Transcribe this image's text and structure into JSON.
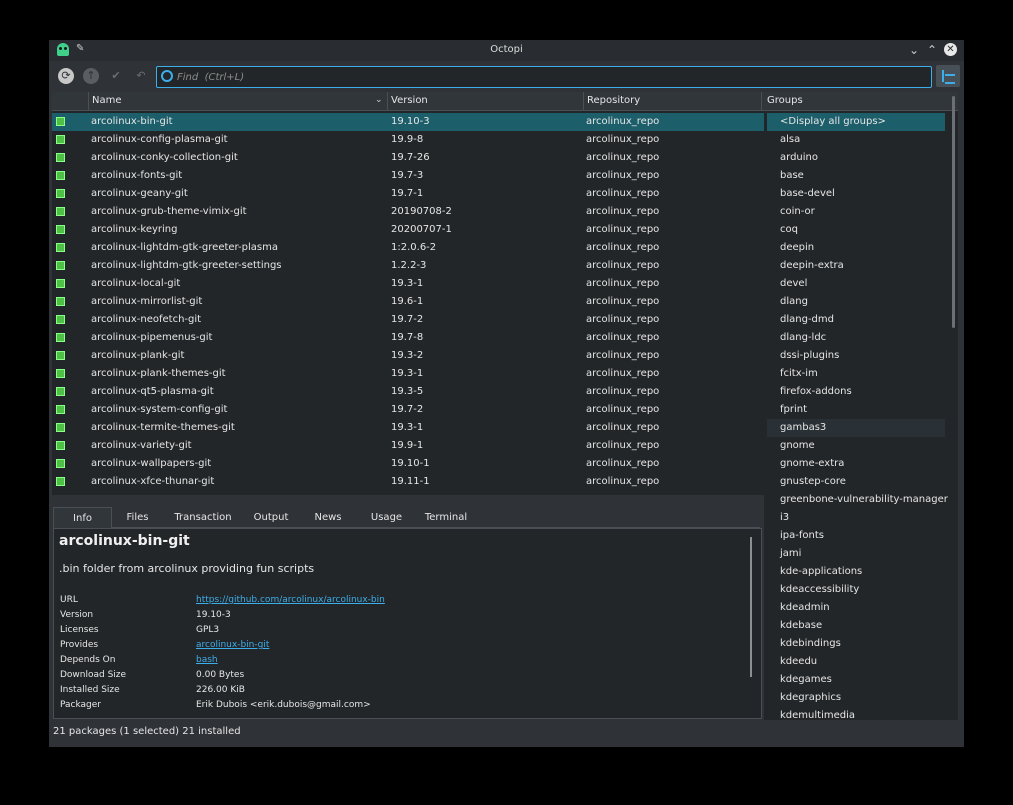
{
  "window": {
    "title": "Octopi"
  },
  "search": {
    "placeholder": "Find  (Ctrl+L)"
  },
  "columns": {
    "name": "Name",
    "version": "Version",
    "repository": "Repository",
    "groups": "Groups"
  },
  "packages": [
    {
      "name": "arcolinux-bin-git",
      "version": "19.10-3",
      "repo": "arcolinux_repo",
      "selected": true
    },
    {
      "name": "arcolinux-config-plasma-git",
      "version": "19.9-8",
      "repo": "arcolinux_repo"
    },
    {
      "name": "arcolinux-conky-collection-git",
      "version": "19.7-26",
      "repo": "arcolinux_repo"
    },
    {
      "name": "arcolinux-fonts-git",
      "version": "19.7-3",
      "repo": "arcolinux_repo"
    },
    {
      "name": "arcolinux-geany-git",
      "version": "19.7-1",
      "repo": "arcolinux_repo"
    },
    {
      "name": "arcolinux-grub-theme-vimix-git",
      "version": "20190708-2",
      "repo": "arcolinux_repo"
    },
    {
      "name": "arcolinux-keyring",
      "version": "20200707-1",
      "repo": "arcolinux_repo"
    },
    {
      "name": "arcolinux-lightdm-gtk-greeter-plasma",
      "version": "1:2.0.6-2",
      "repo": "arcolinux_repo"
    },
    {
      "name": "arcolinux-lightdm-gtk-greeter-settings",
      "version": "1.2.2-3",
      "repo": "arcolinux_repo"
    },
    {
      "name": "arcolinux-local-git",
      "version": "19.3-1",
      "repo": "arcolinux_repo"
    },
    {
      "name": "arcolinux-mirrorlist-git",
      "version": "19.6-1",
      "repo": "arcolinux_repo"
    },
    {
      "name": "arcolinux-neofetch-git",
      "version": "19.7-2",
      "repo": "arcolinux_repo"
    },
    {
      "name": "arcolinux-pipemenus-git",
      "version": "19.7-8",
      "repo": "arcolinux_repo"
    },
    {
      "name": "arcolinux-plank-git",
      "version": "19.3-2",
      "repo": "arcolinux_repo"
    },
    {
      "name": "arcolinux-plank-themes-git",
      "version": "19.3-1",
      "repo": "arcolinux_repo"
    },
    {
      "name": "arcolinux-qt5-plasma-git",
      "version": "19.3-5",
      "repo": "arcolinux_repo"
    },
    {
      "name": "arcolinux-system-config-git",
      "version": "19.7-2",
      "repo": "arcolinux_repo"
    },
    {
      "name": "arcolinux-termite-themes-git",
      "version": "19.3-1",
      "repo": "arcolinux_repo"
    },
    {
      "name": "arcolinux-variety-git",
      "version": "19.9-1",
      "repo": "arcolinux_repo"
    },
    {
      "name": "arcolinux-wallpapers-git",
      "version": "19.10-1",
      "repo": "arcolinux_repo"
    },
    {
      "name": "arcolinux-xfce-thunar-git",
      "version": "19.11-1",
      "repo": "arcolinux_repo"
    }
  ],
  "groups": [
    "<Display all groups>",
    "alsa",
    "arduino",
    "base",
    "base-devel",
    "coin-or",
    "coq",
    "deepin",
    "deepin-extra",
    "devel",
    "dlang",
    "dlang-dmd",
    "dlang-ldc",
    "dssi-plugins",
    "fcitx-im",
    "firefox-addons",
    "fprint",
    "gambas3",
    "gnome",
    "gnome-extra",
    "gnustep-core",
    "greenbone-vulnerability-manager",
    "i3",
    "ipa-fonts",
    "jami",
    "kde-applications",
    "kdeaccessibility",
    "kdeadmin",
    "kdebase",
    "kdebindings",
    "kdeedu",
    "kdegames",
    "kdegraphics",
    "kdemultimedia"
  ],
  "tabs": [
    "Info",
    "Files",
    "Transaction",
    "Output",
    "News",
    "Usage",
    "Terminal"
  ],
  "info": {
    "name": "arcolinux-bin-git",
    "description": ".bin folder from arcolinux providing fun scripts",
    "props": [
      {
        "label": "URL",
        "value": "https://github.com/arcolinux/arcolinux-bin",
        "link": true
      },
      {
        "label": "Version",
        "value": "19.10-3"
      },
      {
        "label": "Licenses",
        "value": "GPL3"
      },
      {
        "label": "Provides",
        "value": "arcolinux-bin-git",
        "link": true
      },
      {
        "label": "Depends On",
        "value": "bash",
        "link": true
      },
      {
        "label": "Download Size",
        "value": "0.00 Bytes"
      },
      {
        "label": "Installed Size",
        "value": "226.00 KiB"
      },
      {
        "label": "Packager",
        "value": "Erik Dubois <erik.dubois@gmail.com>"
      }
    ]
  },
  "status": {
    "text": "21 packages (1 selected)   21 installed"
  },
  "colors": {
    "accent": "#3daee9",
    "selection": "#1d5e6b",
    "installed_icon": "#4fc046"
  }
}
